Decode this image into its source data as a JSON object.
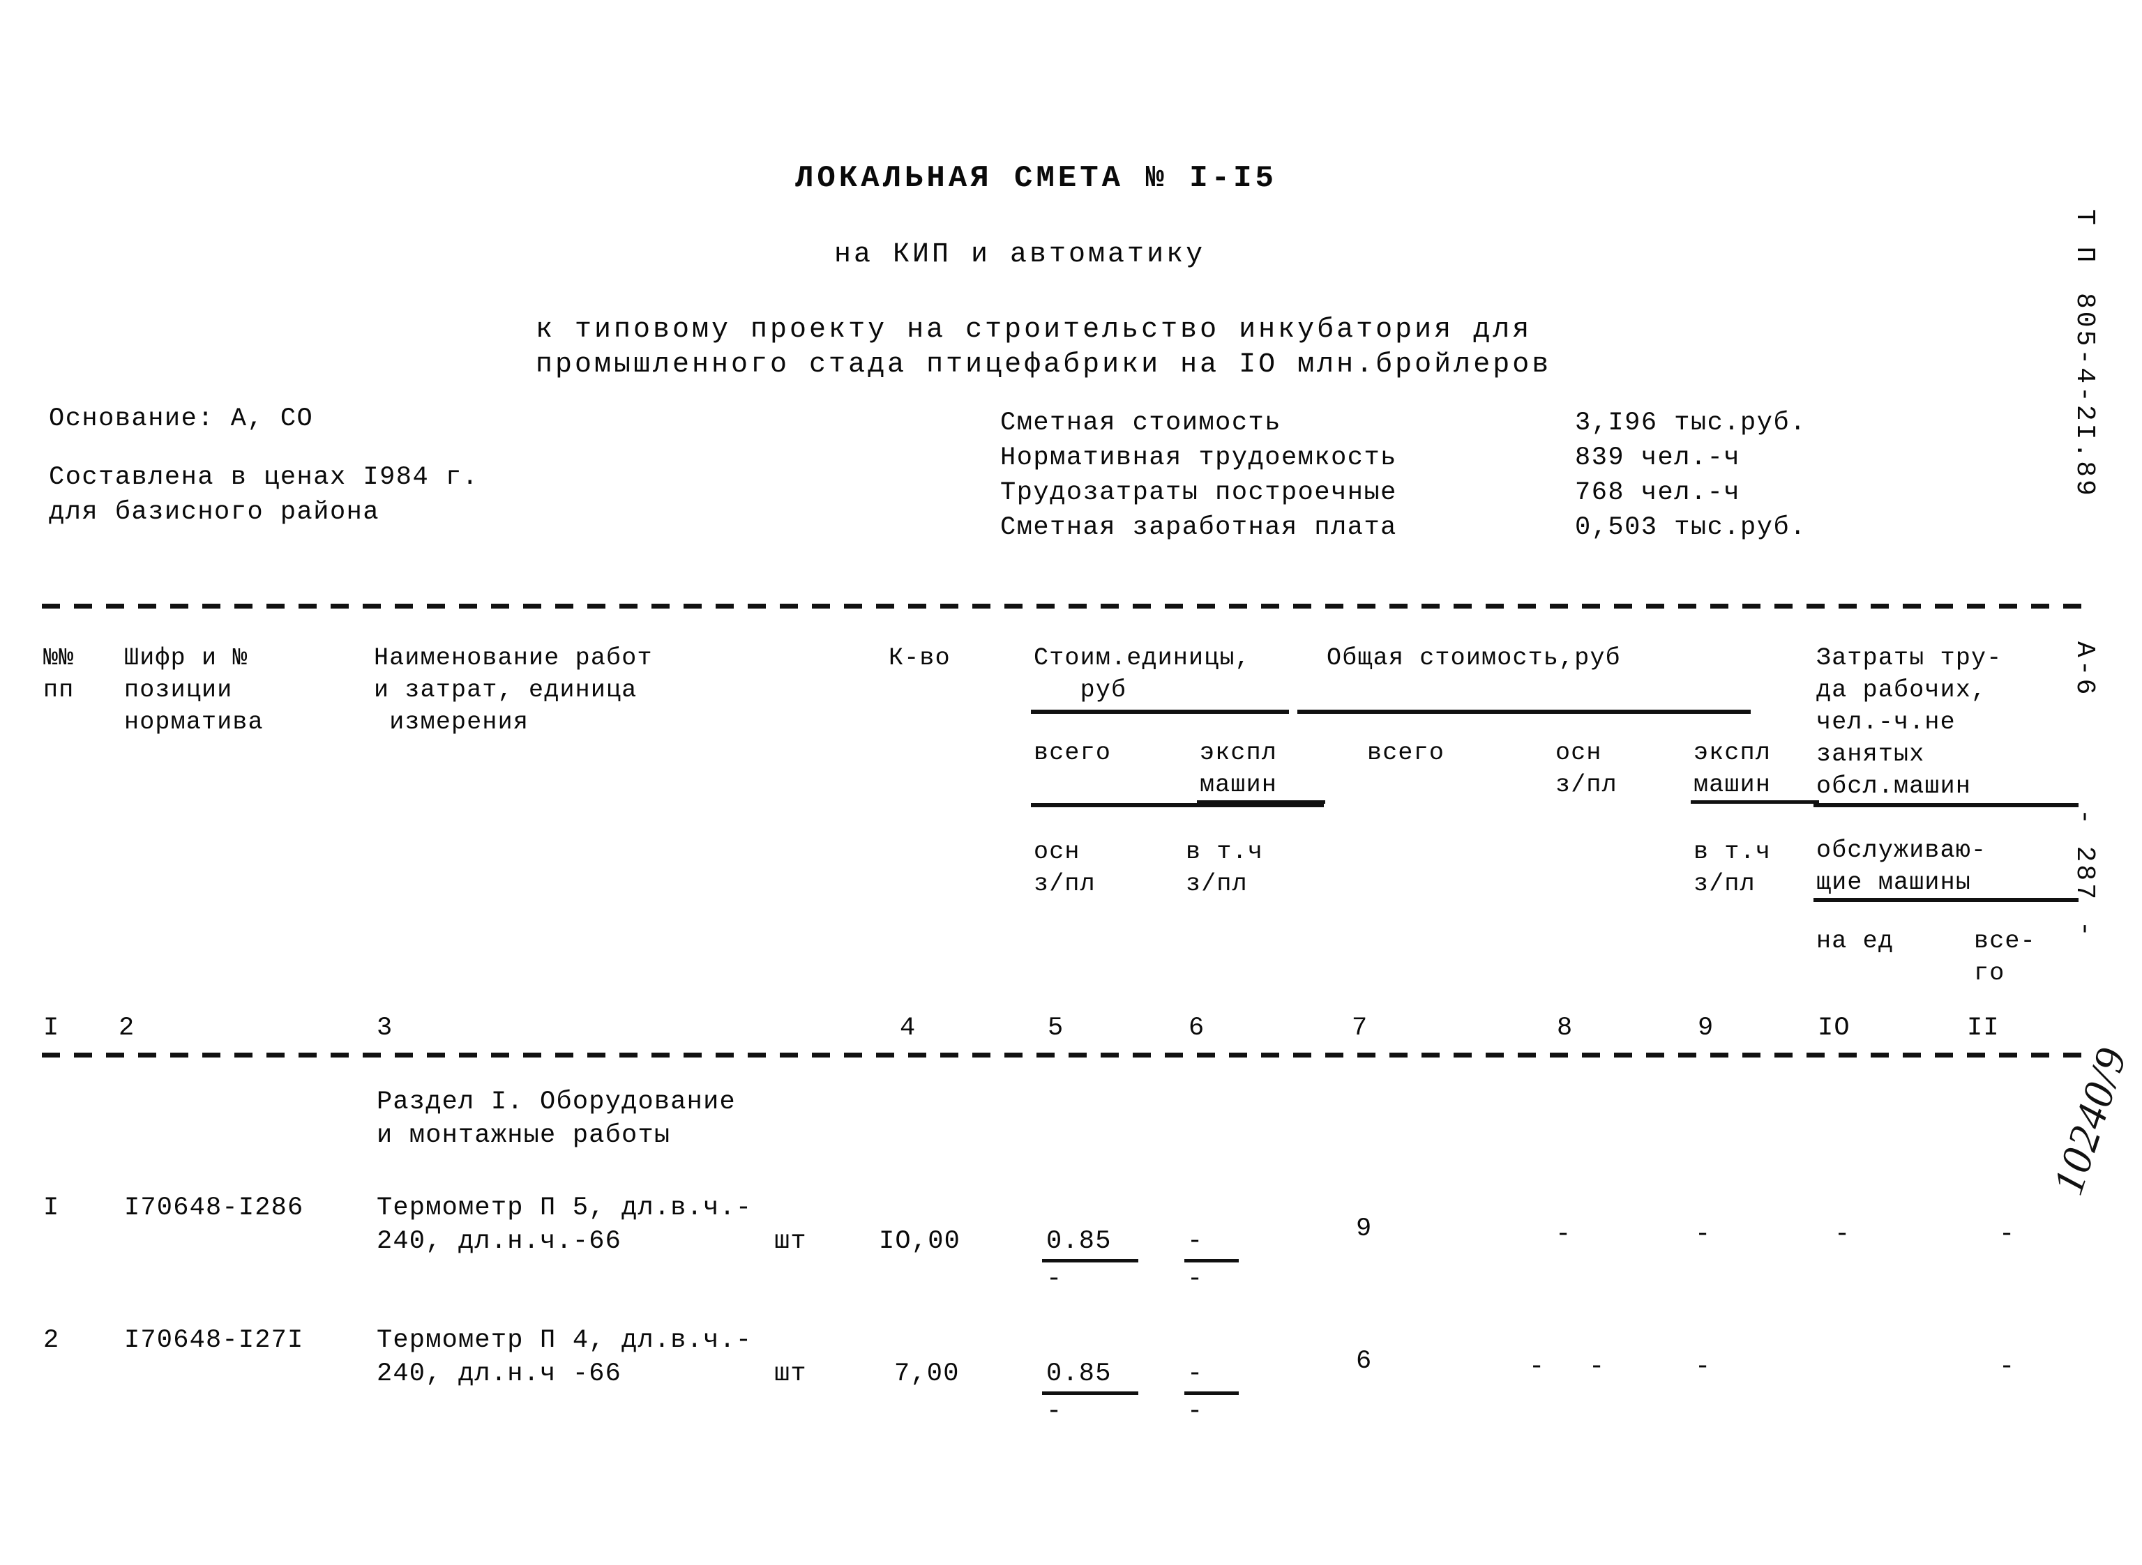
{
  "document": {
    "title": "ЛОКАЛЬНАЯ СМЕТА № I-I5",
    "subtitle": "на КИП и автоматику",
    "project_line_1": "к типовому проекту на строительство инкубатория для",
    "project_line_2": "промышленного стада птицефабрики на IO млн.бройлеров"
  },
  "basis": {
    "osnovanie": "Основание: А, СО",
    "prices_line_1": "Составлена в ценах I984 г.",
    "prices_line_2": "для базисного района"
  },
  "summary": {
    "rows": [
      {
        "label": "Сметная стоимость",
        "value": "3,I96 тыс.руб."
      },
      {
        "label": "Нормативная трудоемкость",
        "value": "839 чел.-ч"
      },
      {
        "label": "Трудозатраты построечные",
        "value": "768 чел.-ч"
      },
      {
        "label": "Сметная заработная плата",
        "value": "0,503 тыс.руб."
      }
    ]
  },
  "table": {
    "head": {
      "col1": [
        "№№",
        "пп"
      ],
      "col2": [
        "Шифр и №",
        "позиции",
        "норматива"
      ],
      "col3": [
        "Наименование работ",
        "и затрат, единица",
        " измерения"
      ],
      "col4": [
        "К-во"
      ],
      "col5_group": [
        "Стоим.единицы,",
        "   руб"
      ],
      "col7_group": [
        "Общая стоимость,руб"
      ],
      "col10_group": [
        "Затраты тру-",
        "да рабочих,",
        "чел.-ч.не",
        "занятых",
        "обсл.машин"
      ],
      "sub_vsego_a": "всего",
      "sub_ekspl_a": "экспл",
      "sub_mashin_a": "машин",
      "sub_vsego_b": "всего",
      "sub_osn_b": "осн",
      "sub_zpl_b": "з/пл",
      "sub_ekspl_b": "экспл",
      "sub_mashin_b": "машин",
      "sub_osn_c": "осн",
      "sub_zpl_c": "з/пл",
      "sub_vtch_c": "в т.ч",
      "sub_zpl_c2": "з/пл",
      "sub_vtch_d": "в т.ч",
      "sub_zpl_d": "з/пл",
      "sub_obsluzh_1": "обслуживаю-",
      "sub_obsluzh_2": "щие машины",
      "sub_naed": "на ед",
      "sub_vsego_1": "все-",
      "sub_vsego_2": "го"
    },
    "column_numbers": [
      "I",
      "2",
      "3",
      "4",
      "5",
      "6",
      "7",
      "8",
      "9",
      "IO",
      "II"
    ],
    "section": {
      "line1": "Раздел I. Оборудование",
      "line2": "и монтажные работы"
    },
    "rows": [
      {
        "no": "I",
        "code": "I70648-I286",
        "name_line1": "Термометр П 5, дл.в.ч.-",
        "name_line2": "240, дл.н.ч.-66",
        "unit": "шт",
        "qty": "IO,00",
        "unit_cost_total": "0.85",
        "unit_cost_osn": "-",
        "unit_cost_mach": "-",
        "unit_cost_mach_zpl": "-",
        "total_cost": "9",
        "total_osn_zpl": "-",
        "total_mach": "-",
        "total_mach_zpl": "-",
        "labor_na_ed": "-",
        "labor_vsego": "-"
      },
      {
        "no": "2",
        "code": "I70648-I27I",
        "name_line1": "Термометр П 4, дл.в.ч.-",
        "name_line2": "240, дл.н.ч -66",
        "unit": "шт",
        "qty": "7,00",
        "unit_cost_total": "0.85",
        "unit_cost_osn": "-",
        "unit_cost_mach": "-",
        "unit_cost_mach_zpl": "-",
        "total_cost": "6",
        "total_osn_zpl": "-",
        "total_mach": "-",
        "total_mach_zpl": "-",
        "labor_na_ed": "-",
        "labor_vsego": "-"
      }
    ]
  },
  "margin": {
    "project_code_1": "Т П",
    "project_code_2": "805-4-2I.89",
    "project_code_3": "А-6",
    "page_number": "- 287 -",
    "hand_annotation": "10240/9"
  }
}
